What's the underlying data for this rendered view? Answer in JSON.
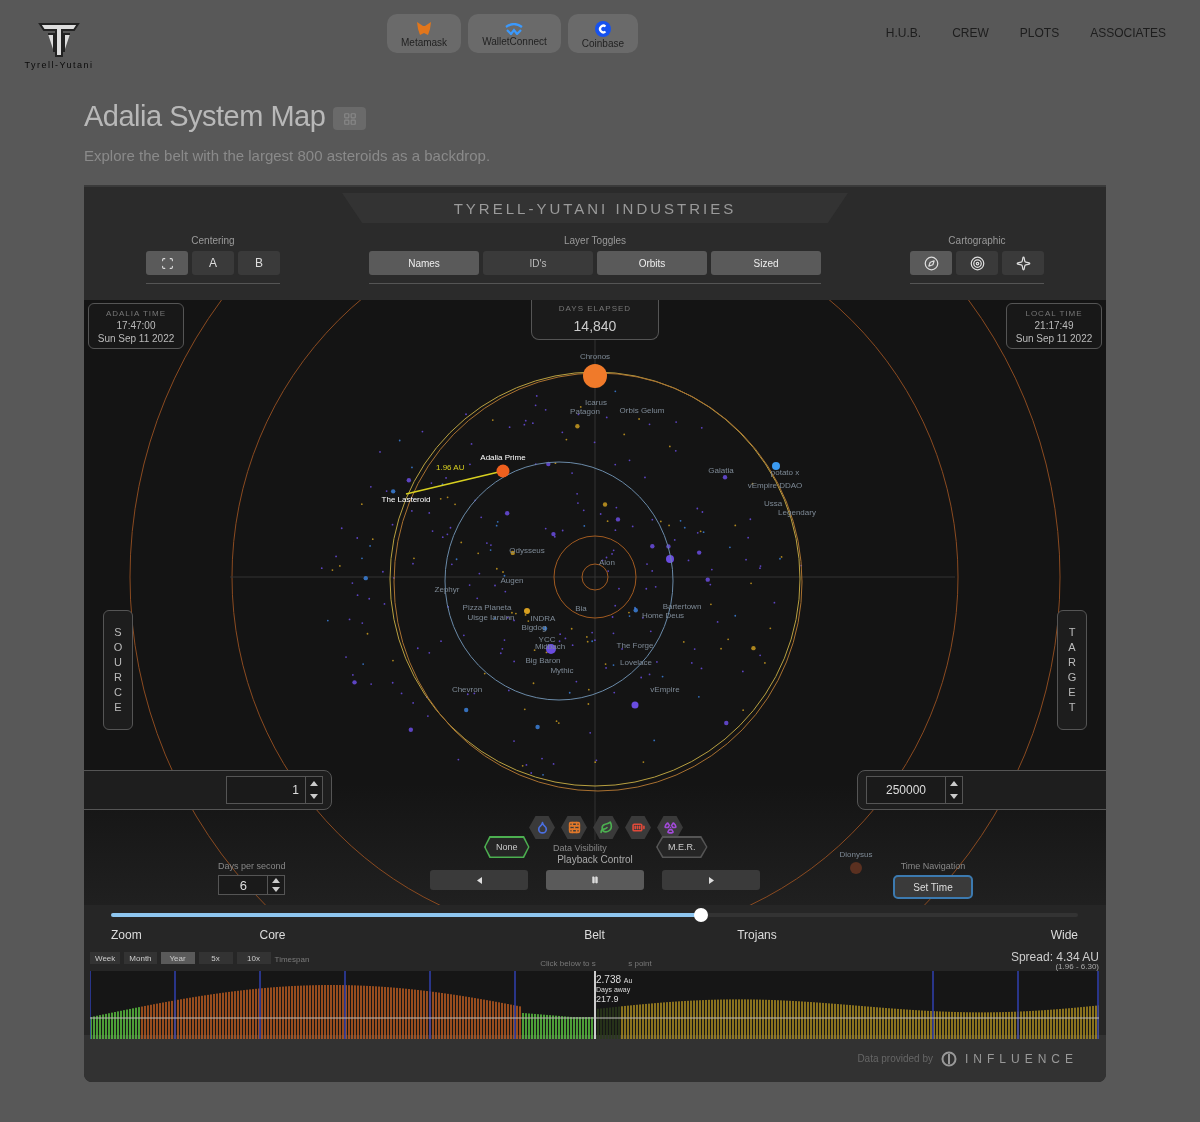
{
  "header": {
    "logo_text": "Tyrell-Yutani",
    "wallets": [
      {
        "label": "Metamask",
        "kind": "fox"
      },
      {
        "label": "WalletConnect",
        "kind": "wave"
      },
      {
        "label": "Coinbase",
        "kind": "coin"
      }
    ],
    "nav": [
      "H.U.B.",
      "CREW",
      "PLOTS",
      "ASSOCIATES"
    ]
  },
  "page": {
    "title": "Adalia System Map",
    "subtitle": "Explore the belt with the largest 800 asteroids as a backdrop."
  },
  "panel": {
    "banner": "TYRELL-YUTANI INDUSTRIES",
    "centering": {
      "label": "Centering",
      "buttons": [
        {
          "kind": "focus",
          "selected": true
        },
        {
          "kind": "text",
          "label": "A",
          "selected": false
        },
        {
          "kind": "text",
          "label": "B",
          "selected": false
        }
      ]
    },
    "layer_toggles": {
      "label": "Layer Toggles",
      "items": [
        {
          "label": "Names",
          "on": true
        },
        {
          "label": "ID's",
          "on": false
        },
        {
          "label": "Orbits",
          "on": true
        },
        {
          "label": "Sized",
          "on": true
        }
      ]
    },
    "cartographic": {
      "label": "Cartographic",
      "buttons": [
        {
          "kind": "compass",
          "selected": true
        },
        {
          "kind": "target",
          "selected": false
        },
        {
          "kind": "star",
          "selected": false
        }
      ]
    },
    "adalia_time": {
      "label": "ADALIA TIME",
      "time": "17:47:00",
      "date": "Sun Sep 11 2022"
    },
    "local_time": {
      "label": "LOCAL TIME",
      "time": "21:17:49",
      "date": "Sun Sep 11 2022"
    },
    "days_elapsed": {
      "label": "DAYS ELAPSED",
      "value": "14,840"
    },
    "map": {
      "distance": "1.96 AU",
      "labels": [
        {
          "name": "Chronos",
          "highlighted": false
        },
        {
          "name": "Icarus",
          "highlighted": false
        },
        {
          "name": "Patagon",
          "highlighted": false
        },
        {
          "name": "Orbis Gelum",
          "highlighted": false
        },
        {
          "name": "Adalia Prime",
          "highlighted": true
        },
        {
          "name": "The Lasteroid",
          "highlighted": true
        },
        {
          "name": "Galatia",
          "highlighted": false
        },
        {
          "name": "potato x",
          "highlighted": false
        },
        {
          "name": "vEmpire DDAO",
          "highlighted": false
        },
        {
          "name": "Ussa",
          "highlighted": false
        },
        {
          "name": "Legendary",
          "highlighted": false
        },
        {
          "name": "Odysseus",
          "highlighted": false
        },
        {
          "name": "Alon",
          "highlighted": false
        },
        {
          "name": "Augen",
          "highlighted": false
        },
        {
          "name": "Zephyr",
          "highlighted": false
        },
        {
          "name": "Pizza Planeta",
          "highlighted": false
        },
        {
          "name": "Uisge Iarainn",
          "highlighted": false
        },
        {
          "name": "INDRA",
          "highlighted": false
        },
        {
          "name": "Bigdog",
          "highlighted": false
        },
        {
          "name": "Bia",
          "highlighted": false
        },
        {
          "name": "Bartertown",
          "highlighted": false
        },
        {
          "name": "Home Deus",
          "highlighted": false
        },
        {
          "name": "YCC",
          "highlighted": false
        },
        {
          "name": "Midbach",
          "highlighted": false
        },
        {
          "name": "The Forge",
          "highlighted": false
        },
        {
          "name": "Big Baron",
          "highlighted": false
        },
        {
          "name": "Lovelace",
          "highlighted": false
        },
        {
          "name": "Mythic",
          "highlighted": false
        },
        {
          "name": "Chevron",
          "highlighted": false
        },
        {
          "name": "vEmpire",
          "highlighted": false
        },
        {
          "name": "Dionysus",
          "highlighted": false
        }
      ]
    },
    "source": {
      "label": "SOURCE",
      "value": "1"
    },
    "target": {
      "label": "TARGET",
      "value": "250000"
    },
    "data_visibility": {
      "label": "Data Visibility",
      "resources": [
        {
          "kind": "water",
          "color": "#4a6fe0"
        },
        {
          "kind": "bricks",
          "color": "#e0782a"
        },
        {
          "kind": "leaf",
          "color": "#4caf50"
        },
        {
          "kind": "battery",
          "color": "#e04a3a"
        },
        {
          "kind": "radiation",
          "color": "#a24ad8"
        }
      ],
      "options": [
        {
          "label": "None",
          "selected": true
        },
        {
          "label": "M.E.R.",
          "selected": false
        }
      ]
    },
    "playback": {
      "label": "Playback Control",
      "buttons": [
        {
          "kind": "back",
          "selected": false
        },
        {
          "kind": "pause",
          "selected": true
        },
        {
          "kind": "forward",
          "selected": false
        }
      ]
    },
    "days_per_second": {
      "label": "Days per second",
      "value": "6"
    },
    "time_navigation": {
      "label": "Time Navigation",
      "button": "Set Time"
    },
    "zoom_slider": {
      "level": 0.61,
      "labels": [
        "Zoom",
        "Core",
        "Belt",
        "Trojans",
        "Wide"
      ]
    },
    "timeline": {
      "timespans": [
        {
          "label": "Week",
          "selected": false
        },
        {
          "label": "Month",
          "selected": false
        },
        {
          "label": "Year",
          "selected": true
        },
        {
          "label": "5x",
          "selected": false
        },
        {
          "label": "10x",
          "selected": false
        }
      ],
      "timespan_label": "Timespan",
      "hint_left": "Click below to s",
      "hint_right": "s point",
      "marker": {
        "distance": "2.738",
        "unit": "Au",
        "caption": "Days away",
        "days": "217.9"
      },
      "spread": "Spread: 4.34 AU",
      "range": "(1.96 - 6.30)"
    },
    "footer": {
      "caption": "Data provided by",
      "logo": "INFLUENCE"
    }
  }
}
